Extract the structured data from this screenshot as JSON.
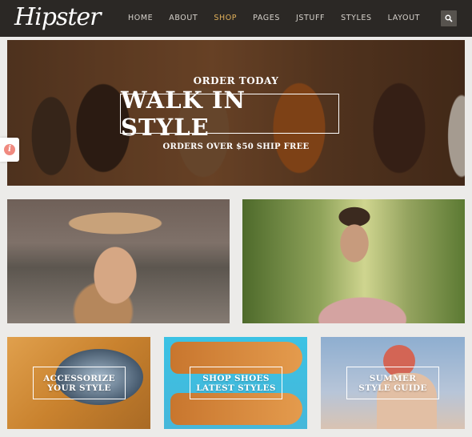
{
  "brand": {
    "logo_text": "Hipster"
  },
  "nav": {
    "items": [
      {
        "label": "HOME",
        "active": false
      },
      {
        "label": "ABOUT",
        "active": false
      },
      {
        "label": "SHOP",
        "active": true
      },
      {
        "label": "PAGES",
        "active": false
      },
      {
        "label": "JSTUFF",
        "active": false
      },
      {
        "label": "STYLES",
        "active": false
      },
      {
        "label": "LAYOUT",
        "active": false
      }
    ],
    "search_icon": "search-icon",
    "active_color": "#e1b05a"
  },
  "hero": {
    "kicker": "ORDER TODAY",
    "title": "WALK IN STYLE",
    "subtitle": "ORDERS OVER $50 SHIP FREE"
  },
  "side_tab": {
    "icon": "info-icon",
    "glyph": "i"
  },
  "promos": [
    {
      "line1": "ACCESSORIZE",
      "line2": "YOUR STYLE"
    },
    {
      "line1": "SHOP SHOES",
      "line2": "LATEST STYLES"
    },
    {
      "line1": "SUMMER",
      "line2": "STYLE GUIDE"
    }
  ]
}
